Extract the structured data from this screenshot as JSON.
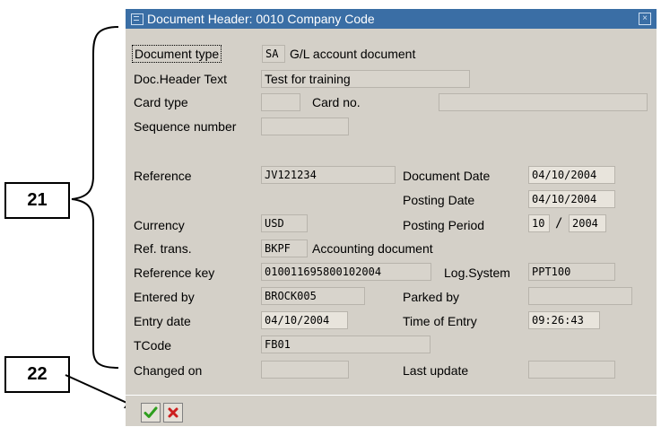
{
  "dialog": {
    "title": "Document Header: 0010 Company Code"
  },
  "fields": {
    "document_type": {
      "label": "Document type",
      "code": "SA",
      "text": "G/L account document"
    },
    "doc_header_text": {
      "label": "Doc.Header Text",
      "value": "Test for training"
    },
    "card_type": {
      "label": "Card type",
      "value": ""
    },
    "card_no": {
      "label": "Card no.",
      "value": ""
    },
    "sequence_number": {
      "label": "Sequence number",
      "value": ""
    },
    "reference": {
      "label": "Reference",
      "value": "JV121234"
    },
    "document_date": {
      "label": "Document Date",
      "value": "04/10/2004"
    },
    "posting_date": {
      "label": "Posting Date",
      "value": "04/10/2004"
    },
    "currency": {
      "label": "Currency",
      "value": "USD"
    },
    "posting_period": {
      "label": "Posting Period",
      "period": "10",
      "separator": "/",
      "year": "2004"
    },
    "ref_trans": {
      "label": "Ref. trans.",
      "code": "BKPF",
      "text": "Accounting document"
    },
    "reference_key": {
      "label": "Reference key",
      "value": "010011695800102004"
    },
    "log_system": {
      "label": "Log.System",
      "value": "PPT100"
    },
    "entered_by": {
      "label": "Entered by",
      "value": "BROCK005"
    },
    "parked_by": {
      "label": "Parked by",
      "value": ""
    },
    "entry_date": {
      "label": "Entry date",
      "value": "04/10/2004"
    },
    "time_of_entry": {
      "label": "Time of Entry",
      "value": "09:26:43"
    },
    "tcode": {
      "label": "TCode",
      "value": "FB01"
    },
    "changed_on": {
      "label": "Changed on",
      "value": ""
    },
    "last_update": {
      "label": "Last update",
      "value": ""
    }
  },
  "buttons": {
    "continue_icon": "check-icon",
    "cancel_icon": "cancel-icon"
  },
  "callouts": {
    "label_21": "21",
    "label_22": "22"
  },
  "colors": {
    "title_bar": "#3a6ea5",
    "dialog_bg": "#d4d0c8",
    "check_green": "#2e9e1e",
    "cancel_red": "#cc1f1f"
  }
}
